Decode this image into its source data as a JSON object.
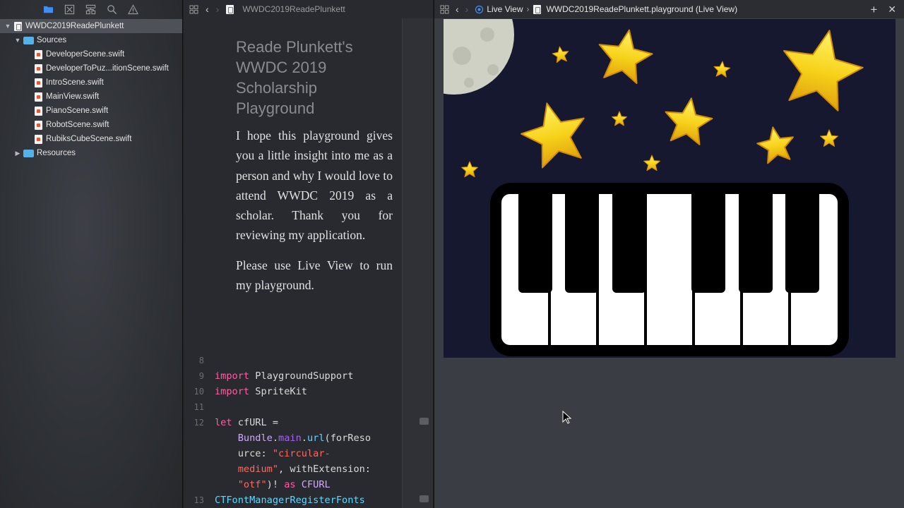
{
  "navigator": {
    "project": "WWDC2019ReadePlunkett",
    "sources_folder": "Sources",
    "files": [
      "DeveloperScene.swift",
      "DeveloperToPuz...itionScene.swift",
      "IntroScene.swift",
      "MainView.swift",
      "PianoScene.swift",
      "RobotScene.swift",
      "RubiksCubeScene.swift"
    ],
    "resources_folder": "Resources",
    "toolbar_icons": [
      "folder-icon",
      "source-control-icon",
      "hierarchy-icon",
      "find-icon",
      "warning-icon"
    ]
  },
  "editor": {
    "breadcrumb": "WWDC2019ReadePlunkett",
    "markup_title": "Reade Plunkett's WWDC 2019 Scholarship Playground",
    "paragraph1": "I hope this playground gives you a little insight into me as a person and why I would love to attend WWDC 2019 as a scholar. Thank you for reviewing my application.",
    "paragraph2": "Please use Live View to run my playground.",
    "lines": {
      "n8": "8",
      "n9": "9",
      "n10": "10",
      "n11": "11",
      "n12": "12",
      "n13": "13",
      "import_kw": "import",
      "playground_support": "PlaygroundSupport",
      "spritekit": "SpriteKit",
      "let_kw": "let",
      "cfurl_decl": "cfURL =",
      "bundle": "Bundle",
      "main": "main",
      "url": "url",
      "for_reso": "(forReso",
      "urce": "urce: ",
      "circular_str": "\"circular-",
      "medium_str": "medium\"",
      "with_ext": ", withExtension:",
      "otf_str": "\"otf\"",
      "as_suffix": ")! ",
      "as_kw": "as",
      "cfurl_type": "CFURL",
      "ctfont": "CTFontManagerRegisterFonts"
    }
  },
  "assistant": {
    "mode": "Live View",
    "file": "WWDC2019ReadePlunkett.playground (Live View)"
  },
  "colors": {
    "sky": "#15182f",
    "star": "#f7d21a",
    "moon": "#cfd1c4",
    "piano_frame": "#000000",
    "white_key": "#ffffff"
  }
}
